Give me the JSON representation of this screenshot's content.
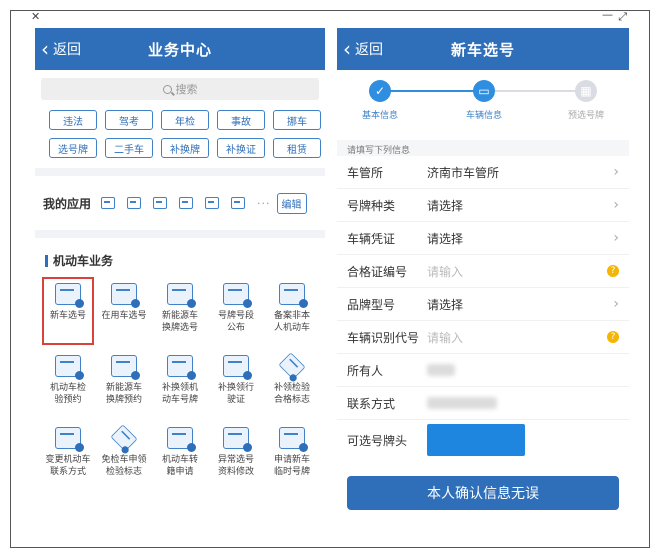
{
  "window": {
    "close_glyph": "✕",
    "minimize_glyph": "—",
    "maximize_glyph": "⤢"
  },
  "left": {
    "back": "返回",
    "title": "业务中心",
    "search_placeholder": "搜索",
    "quick_items": [
      "违法",
      "驾考",
      "年检",
      "事故",
      "挪车",
      "选号牌",
      "二手车",
      "补换牌",
      "补换证",
      "租赁"
    ],
    "my_apps_label": "我的应用",
    "more_dots": "···",
    "edit_label": "编辑",
    "section_title": "机动车业务",
    "biz_items": [
      {
        "label": "新车选号",
        "icon": "new-car-plate-icon"
      },
      {
        "label": "在用车选号",
        "icon": "car-in-use-icon"
      },
      {
        "label": "新能源车\n换牌选号",
        "icon": "ev-car-icon"
      },
      {
        "label": "号牌号段\n公布",
        "icon": "plate-range-icon"
      },
      {
        "label": "备案非本\n人机动车",
        "icon": "record-card-icon"
      },
      {
        "label": "机动车检\n验预约",
        "icon": "inspection-icon"
      },
      {
        "label": "新能源车\n换牌预约",
        "icon": "ev-plate-icon"
      },
      {
        "label": "补换领机\n动车号牌",
        "icon": "replace-plate-icon"
      },
      {
        "label": "补换领行\n驶证",
        "icon": "license-icon"
      },
      {
        "label": "补领检验\n合格标志",
        "icon": "badge-icon"
      },
      {
        "label": "变更机动车\n联系方式",
        "icon": "contact-icon"
      },
      {
        "label": "免检车申领\n检验标志",
        "icon": "exempt-icon"
      },
      {
        "label": "机动车转\n籍申请",
        "icon": "transfer-icon"
      },
      {
        "label": "异常选号\n资料修改",
        "icon": "edit-doc-icon"
      },
      {
        "label": "申请新车\n临时号牌",
        "icon": "temp-plate-icon"
      }
    ]
  },
  "right": {
    "back": "返回",
    "title": "新车选号",
    "steps": [
      {
        "label": "基本信息",
        "state": "done"
      },
      {
        "label": "车辆信息",
        "state": "active"
      },
      {
        "label": "预选号牌",
        "state": "todo"
      }
    ],
    "hint": "请填写下列信息",
    "rows": [
      {
        "key": "车管所",
        "value": "济南市车管所",
        "placeholder": false,
        "trail": "arrow"
      },
      {
        "key": "号牌种类",
        "value": "请选择",
        "placeholder": false,
        "trail": "arrow"
      },
      {
        "key": "车辆凭证",
        "value": "请选择",
        "placeholder": false,
        "trail": "arrow"
      },
      {
        "key": "合格证编号",
        "value": "请输入",
        "placeholder": true,
        "trail": "help"
      },
      {
        "key": "品牌型号",
        "value": "请选择",
        "placeholder": false,
        "trail": "arrow"
      },
      {
        "key": "车辆识别代号",
        "value": "请输入",
        "placeholder": true,
        "trail": "help"
      }
    ],
    "owner_label": "所有人",
    "contact_label": "联系方式",
    "plate_prefix_label": "可选号牌头",
    "confirm": "本人确认信息无误",
    "arrow_glyph": "›",
    "help_glyph": "?"
  },
  "colors": {
    "brand": "#2f6fb9",
    "highlight": "#d9423a",
    "accent": "#2f8ee0",
    "warning": "#f5b500"
  }
}
